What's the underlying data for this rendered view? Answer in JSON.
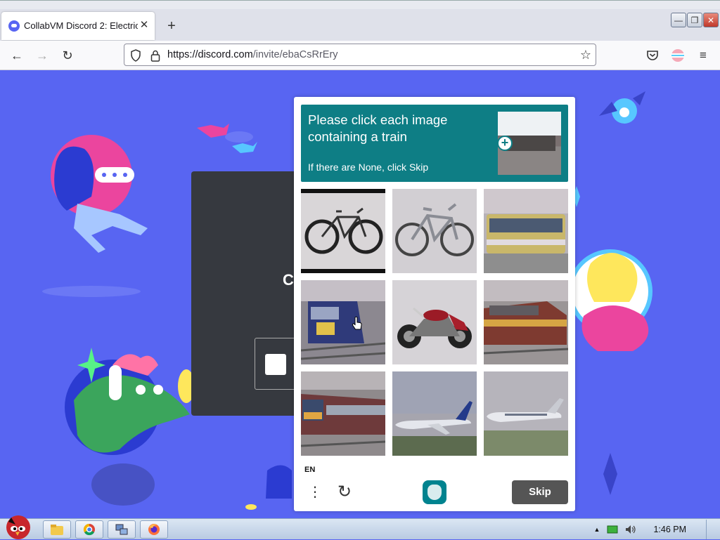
{
  "browser": {
    "tab_title": "CollabVM Discord 2: Electric",
    "tab_close": "✕",
    "new_tab": "+",
    "url_host": "https://discord.com",
    "url_path": "/invite/ebaCsRrEry",
    "back": "←",
    "forward": "→",
    "reload": "↻",
    "star": "☆",
    "menu": "≡",
    "window_controls": {
      "minimize": "—",
      "restore": "❐",
      "close": "✕"
    }
  },
  "page": {
    "partial_text": "C",
    "background_color": "#5865f2"
  },
  "captcha": {
    "prompt_title": "Please click each image containing a train",
    "prompt_sub": "If there are None, click Skip",
    "prompt_plus": "+",
    "accent_color": "#0e7e85",
    "tiles": [
      {
        "subject": "bicycle"
      },
      {
        "subject": "bicycle"
      },
      {
        "subject": "bus"
      },
      {
        "subject": "train"
      },
      {
        "subject": "motorcycle"
      },
      {
        "subject": "train"
      },
      {
        "subject": "train"
      },
      {
        "subject": "airplane"
      },
      {
        "subject": "airplane"
      }
    ],
    "language": "EN",
    "menu_dots": "⋮",
    "refresh_icon": "↻",
    "skip_label": "Skip"
  },
  "taskbar": {
    "items": [
      "explorer-icon",
      "chrome-icon",
      "network-icon",
      "firefox-icon"
    ],
    "tray_arrow": "▲",
    "clock": "1:46 PM"
  }
}
